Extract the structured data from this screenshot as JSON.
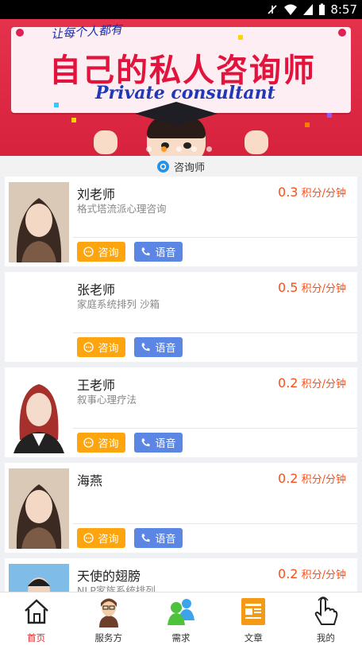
{
  "status_bar": {
    "time": "8:57"
  },
  "banner": {
    "small_title": "让每个人都有",
    "title": "自己的私人咨询师",
    "subtitle": "Private consultant",
    "active_slide": 1,
    "slide_count": 5
  },
  "section": {
    "title": "咨询师"
  },
  "consultants": [
    {
      "name": "刘老师",
      "desc": "格式塔流派心理咨询",
      "price": "0.3",
      "unit": "积分/分钟",
      "has_photo": true,
      "photo": "woman-long-hair"
    },
    {
      "name": "张老师",
      "desc": "家庭系统排列 沙箱",
      "price": "0.5",
      "unit": "积分/分钟",
      "has_photo": false,
      "photo": ""
    },
    {
      "name": "王老师",
      "desc": "叙事心理疗法",
      "price": "0.2",
      "unit": "积分/分钟",
      "has_photo": true,
      "photo": "woman-red-hair"
    },
    {
      "name": "海燕",
      "desc": "",
      "price": "0.2",
      "unit": "积分/分钟",
      "has_photo": true,
      "photo": "woman-long-hair"
    },
    {
      "name": "天使的翅膀",
      "desc": "NLP家族系统排列",
      "price": "0.2",
      "unit": "积分/分钟",
      "has_photo": true,
      "photo": "man-blue"
    }
  ],
  "buttons": {
    "consult": "咨询",
    "voice": "语音"
  },
  "tabs": [
    {
      "label": "首页",
      "icon": "home-icon",
      "active": true
    },
    {
      "label": "服务方",
      "icon": "service-provider-icon",
      "active": false
    },
    {
      "label": "需求",
      "icon": "chat-people-icon",
      "active": false
    },
    {
      "label": "文章",
      "icon": "article-icon",
      "active": false
    },
    {
      "label": "我的",
      "icon": "hand-touch-icon",
      "active": false
    }
  ],
  "colors": {
    "accent_orange": "#fda50f",
    "voice_blue": "#5b86e4",
    "price_orange": "#f5501c",
    "active_tab": "#e02b2b"
  }
}
